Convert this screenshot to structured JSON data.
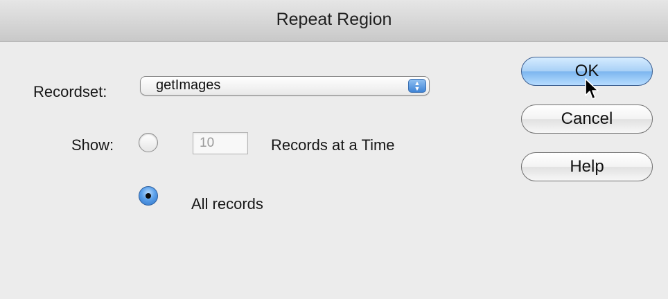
{
  "window": {
    "title": "Repeat Region"
  },
  "recordset": {
    "label": "Recordset:",
    "selected": "getImages"
  },
  "show": {
    "label": "Show:",
    "option_count": {
      "value": "10",
      "suffix": "Records at a Time",
      "selected": false
    },
    "option_all": {
      "label": "All records",
      "selected": true
    }
  },
  "buttons": {
    "ok": "OK",
    "cancel": "Cancel",
    "help": "Help"
  },
  "colors": {
    "window_bg": "#ececec",
    "titlebar_top": "#e6e6e6",
    "titlebar_bottom": "#c9c9c9",
    "default_button": "#a8d0f6",
    "radio_selected": "#5aa0ea"
  },
  "icons": {
    "select_arrows": "up-down-arrows-icon",
    "cursor": "mouse-pointer-icon"
  }
}
